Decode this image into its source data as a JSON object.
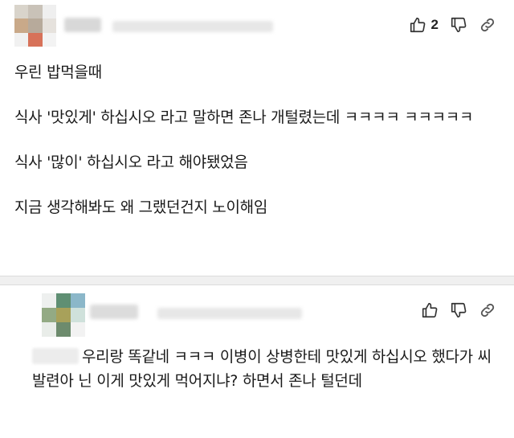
{
  "comment1": {
    "avatar": {
      "colors": [
        "#d9d4cb",
        "#c9c2b8",
        "#efefef",
        "#c9a989",
        "#b7aa9b",
        "#e6e2dd",
        "#f1f1f1",
        "#d77259",
        "#f3f3f3"
      ]
    },
    "likes": {
      "count": "2",
      "icon": "thumbs-up-icon"
    },
    "dislike_icon": "thumbs-down-icon",
    "share_icon": "link-icon",
    "paragraphs": [
      "우린 밥먹을때",
      "식사 '맛있게' 하십시오 라고 말하면 존나 개털렸는데 ㅋㅋㅋㅋ ㅋㅋㅋㅋㅋ",
      "식사 '많이' 하십시오 라고 해야됐었음",
      "지금 생각해봐도 왜 그랬던건지 노이해임"
    ]
  },
  "comment2": {
    "avatar": {
      "colors": [
        "#eef0ef",
        "#5f8f73",
        "#8bb7c9",
        "#93aa84",
        "#a8a15a",
        "#cfe1db",
        "#e9ede9",
        "#6d8b6d",
        "#f2f2f2"
      ]
    },
    "like_icon": "thumbs-up-icon",
    "dislike_icon": "thumbs-down-icon",
    "share_icon": "link-icon",
    "text": "우리랑 똑같네 ㅋㅋㅋ 이병이 상병한테 맛있게 하십시오 했다가 씨발련아 닌 이게 맛있게 먹어지냐? 하면서 존나 털던데"
  }
}
